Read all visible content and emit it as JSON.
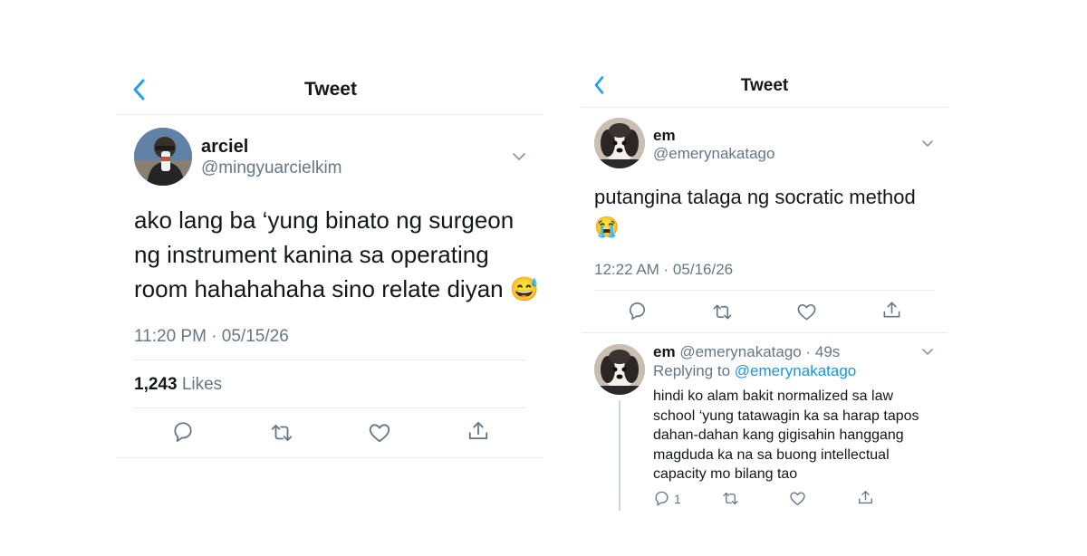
{
  "left": {
    "header": {
      "title": "Tweet"
    },
    "tweet": {
      "display_name": "arciel",
      "handle": "@mingyuarcielkim",
      "text_lines": [
        "ako lang ba ‘yung binato ng surgeon",
        "ng instrument kanina sa operating",
        "room hahahahaha sino relate diyan"
      ],
      "emoji": "😅",
      "timestamp": "11:20 PM · 05/15/26",
      "likes_count": "1,243",
      "likes_label": "Likes"
    }
  },
  "right": {
    "header": {
      "title": "Tweet"
    },
    "tweet": {
      "display_name": "em",
      "handle": "@emerynakatago",
      "text": "putangina talaga ng socratic method",
      "emoji": "😭",
      "timestamp": "12:22 AM · 05/16/26"
    },
    "reply": {
      "display_name": "em",
      "handle_time": "@emerynakatago · 49s",
      "replying_to_label": "Replying to",
      "replying_to_handle": "@emerynakatago",
      "text_lines": [
        "hindi ko alam bakit normalized sa law",
        "school ‘yung tatawagin ka sa harap tapos",
        "dahan-dahan kang gigisahin hanggang",
        "magduda ka na sa buong intellectual",
        "capacity mo bilang tao"
      ],
      "reply_count": "1"
    }
  },
  "colors": {
    "accent": "#1da1f2",
    "link": "#1b95e0",
    "muted": "#657786",
    "divider": "#e6ecf0"
  }
}
